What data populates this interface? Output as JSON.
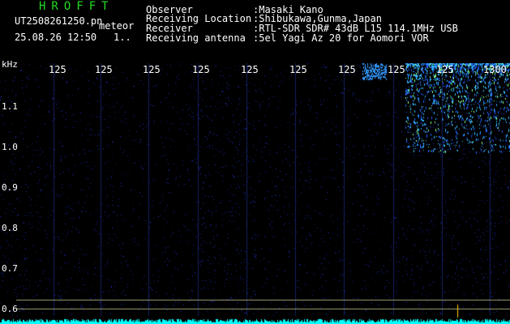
{
  "header": {
    "logo": "HROFFT",
    "filename": "UT2508261250.pn",
    "tag": "meteor",
    "datetime": "25.08.26 12:50",
    "page_marker": "1..",
    "info": [
      {
        "label": "Observer",
        "value": ":Masaki Kano"
      },
      {
        "label": "Receiving Location",
        "value": ":Shibukawa,Gunma,Japan"
      },
      {
        "label": "Receiver",
        "value": ":RTL-SDR SDR# 43dB L15 114.1MHz USB"
      },
      {
        "label": "Receiving antenna",
        "value": ":5el Yagi Az 20 for Aomori VOR"
      }
    ]
  },
  "axis": {
    "unit": "kHz",
    "y_ticks": [
      "1.1",
      "1.0",
      "0.9",
      "0.8",
      "0.7",
      "0.6"
    ],
    "x_ticks": [
      "125",
      "125",
      "125",
      "125",
      "125",
      "125",
      "125",
      "125",
      "125",
      "1300"
    ]
  },
  "colors": {
    "background": "#000000",
    "noise": "#1a2aa0",
    "signal": "#33bbff",
    "baseline": "#00ffff",
    "logo": "#22dd22"
  }
}
